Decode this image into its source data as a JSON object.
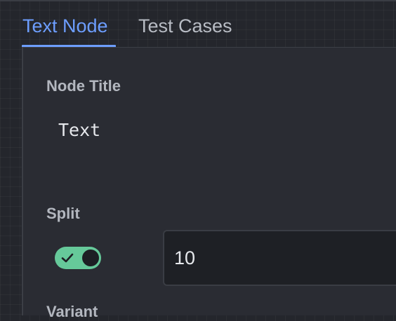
{
  "tabs": [
    {
      "label": "Text Node",
      "active": true
    },
    {
      "label": "Test Cases",
      "active": false
    }
  ],
  "fields": {
    "node_title": {
      "label": "Node Title",
      "value": "Text"
    },
    "split": {
      "label": "Split",
      "toggle_on": true,
      "value": "10"
    },
    "variant": {
      "label": "Variant"
    }
  },
  "colors": {
    "accent": "#6d9eff",
    "toggle_on": "#66c99a",
    "background": "#24262c",
    "panel": "#2a2c33"
  },
  "icons": {
    "toggle_check": "check-icon"
  }
}
